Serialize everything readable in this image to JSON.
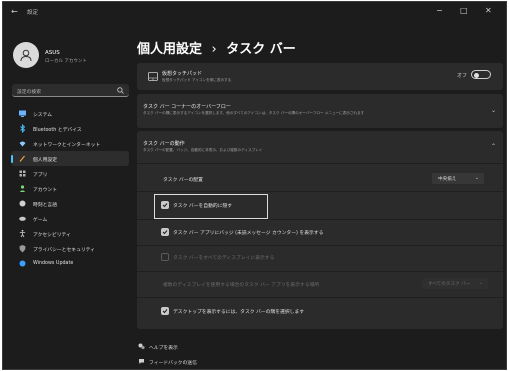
{
  "window": {
    "app_title": "設定",
    "back_glyph": "←",
    "minimize_glyph": "−",
    "maximize_glyph": "□",
    "close_glyph": "✕"
  },
  "user": {
    "name": "ASUS",
    "role": "ローカル アカウント"
  },
  "search": {
    "placeholder": "設定の検索"
  },
  "sidebar": {
    "items": [
      {
        "label": "システム",
        "icon": "monitor-icon"
      },
      {
        "label": "Bluetooth とデバイス",
        "icon": "bluetooth-icon"
      },
      {
        "label": "ネットワークとインターネット",
        "icon": "wifi-icon"
      },
      {
        "label": "個人用設定",
        "icon": "pen-icon",
        "active": true
      },
      {
        "label": "アプリ",
        "icon": "apps-icon"
      },
      {
        "label": "アカウント",
        "icon": "person-icon"
      },
      {
        "label": "時刻と言語",
        "icon": "globe-clock-icon"
      },
      {
        "label": "ゲーム",
        "icon": "gamepad-icon"
      },
      {
        "label": "アクセシビリティ",
        "icon": "accessibility-icon"
      },
      {
        "label": "プライバシーとセキュリティ",
        "icon": "shield-icon"
      },
      {
        "label": "Windows Update",
        "icon": "update-icon"
      }
    ],
    "accent": "#4cc2ff"
  },
  "page": {
    "breadcrumb_parent": "個人用設定",
    "breadcrumb_sep": "›",
    "breadcrumb_current": "タスク バー"
  },
  "touchpad_card": {
    "title": "仮想タッチパッド",
    "desc": "仮想タッチパッド アイコンを常に表示する",
    "toggle_label": "オフ",
    "toggle_on": false
  },
  "overflow_card": {
    "title": "タスク バー コーナーのオーバーフロー",
    "desc": "タスク バーの隅に表示するアイコンを選択します。他のすべてのアイコンは、タスク バーの隅のオーバーフロー メニューに表示されます"
  },
  "behavior_card": {
    "title": "タスク バーの動作",
    "desc": "タスク バーの配置、バッジ、自動的に非表示、および複数のディスプレイ",
    "alignment_label": "タスク バーの配置",
    "alignment_value": "中央揃え",
    "autohide_label": "タスク バーを自動的に隠す",
    "autohide_checked": true,
    "badges_label": "タスク バー アプリにバッジ (未読メッセージ カウンター) を表示する",
    "badges_checked": true,
    "all_displays_label": "タスク バーをすべてのディスプレイに表示する",
    "all_displays_checked": false,
    "multi_display_label": "複数のディスプレイを使用する場合のタスク バー アプリを表示する場所",
    "multi_display_value": "すべてのタスク バー",
    "desktop_corner_label": "デスクトップを表示するには、タスク バーの隅を選択します",
    "desktop_corner_checked": true
  },
  "footer": {
    "help_label": "ヘルプを表示",
    "feedback_label": "フィードバックの送信"
  }
}
